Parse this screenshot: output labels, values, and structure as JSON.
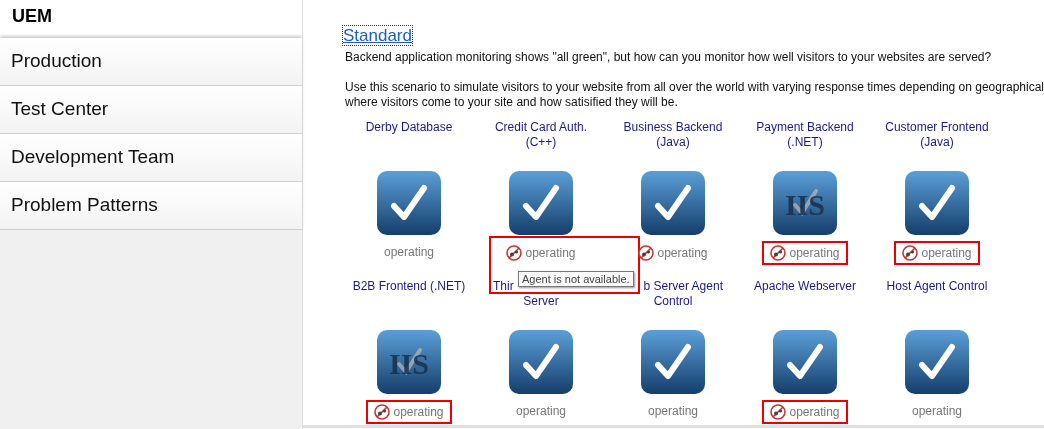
{
  "sidebar": {
    "title": "UEM",
    "items": [
      {
        "label": "Production"
      },
      {
        "label": "Test Center"
      },
      {
        "label": "Development Team"
      },
      {
        "label": "Problem Patterns"
      }
    ]
  },
  "content": {
    "link": "Standard",
    "paragraphs": [
      "Backend application monitoring shows \"all green\", but how can you monitor how well visitors to your websites are served?",
      "Use this scenario to simulate visitors to your website from all over the world with varying response times depending on geographical\nwhere visitors come to your site and how satisified they will be."
    ],
    "services": [
      {
        "label": [
          "Derby Database"
        ],
        "kind": "check",
        "status": "operating",
        "agent_unavailable": false,
        "highlighted": false
      },
      {
        "label": [
          "Credit Card Auth.",
          "(C++)"
        ],
        "kind": "check",
        "status": "operating",
        "agent_unavailable": true,
        "highlighted": true,
        "tooltip": "Agent is not available."
      },
      {
        "label": [
          "Business Backend",
          "(Java)"
        ],
        "kind": "check",
        "status": "operating",
        "agent_unavailable": true,
        "highlighted": false
      },
      {
        "label": [
          "Payment Backend",
          "(.NET)"
        ],
        "kind": "iis",
        "logo_text": "IIS",
        "status": "operating",
        "agent_unavailable": true,
        "highlighted": true
      },
      {
        "label": [
          "Customer Frontend",
          "(Java)"
        ],
        "kind": "check",
        "status": "operating",
        "agent_unavailable": true,
        "highlighted": true
      },
      {
        "label": [
          "B2B Frontend (.NET)"
        ],
        "kind": "iis",
        "logo_text": "IIS",
        "status": "operating",
        "agent_unavailable": true,
        "highlighted": true
      },
      {
        "label": [
          "Thir",
          "Server"
        ],
        "first_line_cut_right": true,
        "kind": "check",
        "status": "operating",
        "agent_unavailable": false,
        "highlighted": false
      },
      {
        "label": [
          "b Server Agent",
          "Control"
        ],
        "first_line_cut_left": true,
        "kind": "check",
        "status": "operating",
        "agent_unavailable": false,
        "highlighted": false
      },
      {
        "label": [
          "Apache Webserver"
        ],
        "kind": "check",
        "status": "operating",
        "agent_unavailable": true,
        "highlighted": true
      },
      {
        "label": [
          "Host Agent Control"
        ],
        "kind": "check",
        "status": "operating",
        "agent_unavailable": false,
        "highlighted": false
      }
    ]
  }
}
